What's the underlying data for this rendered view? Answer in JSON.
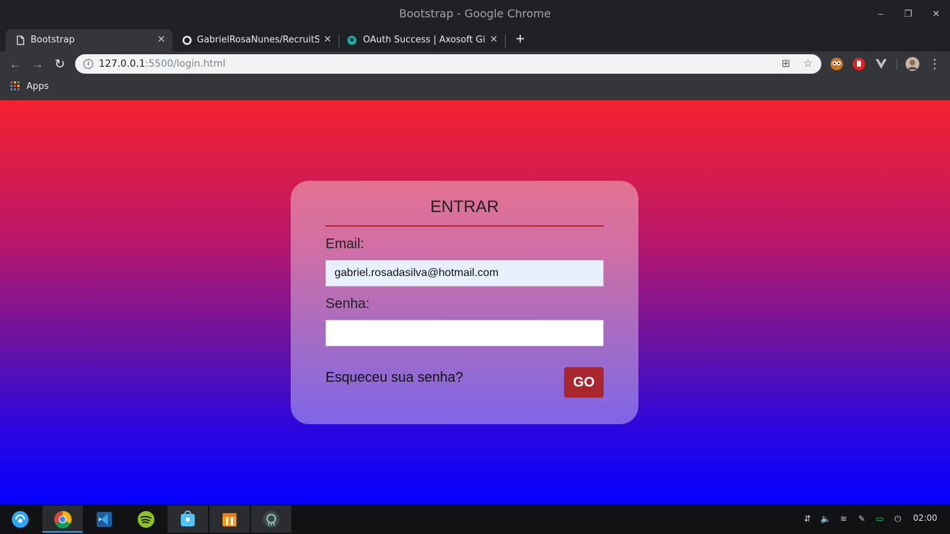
{
  "window": {
    "title": "Bootstrap - Google Chrome",
    "minimize": "–",
    "restore": "❐",
    "close": "✕"
  },
  "tabs": [
    {
      "label": "Bootstrap",
      "close": "✕"
    },
    {
      "label": "GabrielRosaNunes/RecruitSyste",
      "close": "✕"
    },
    {
      "label": "OAuth Success | Axosoft GitKra",
      "close": "✕"
    }
  ],
  "newtab": "+",
  "nav": {
    "back": "←",
    "forward": "→",
    "reload": "↻",
    "menu": "⋮"
  },
  "address": {
    "host": "127.0.0.1",
    "path": ":5500/login.html",
    "info": "i",
    "translate": "⊞",
    "star": "☆"
  },
  "bookmarks": {
    "apps_label": "Apps"
  },
  "login": {
    "title": "ENTRAR",
    "email_label": "Email:",
    "email_value": "gabriel.rosadasilva@hotmail.com",
    "password_label": "Senha:",
    "password_value": "",
    "forgot_label": "Esqueceu sua senha?",
    "submit_label": "GO"
  },
  "tray": {
    "usb": "⇵",
    "volume": "🔈",
    "wifi": "≋",
    "pen": "✎",
    "battery": "▭",
    "power": "⏻"
  },
  "clock": "02:00",
  "colors": {
    "accent": "#a8262d",
    "gradient_top": "#f5212e",
    "gradient_bottom": "#0400ff"
  }
}
